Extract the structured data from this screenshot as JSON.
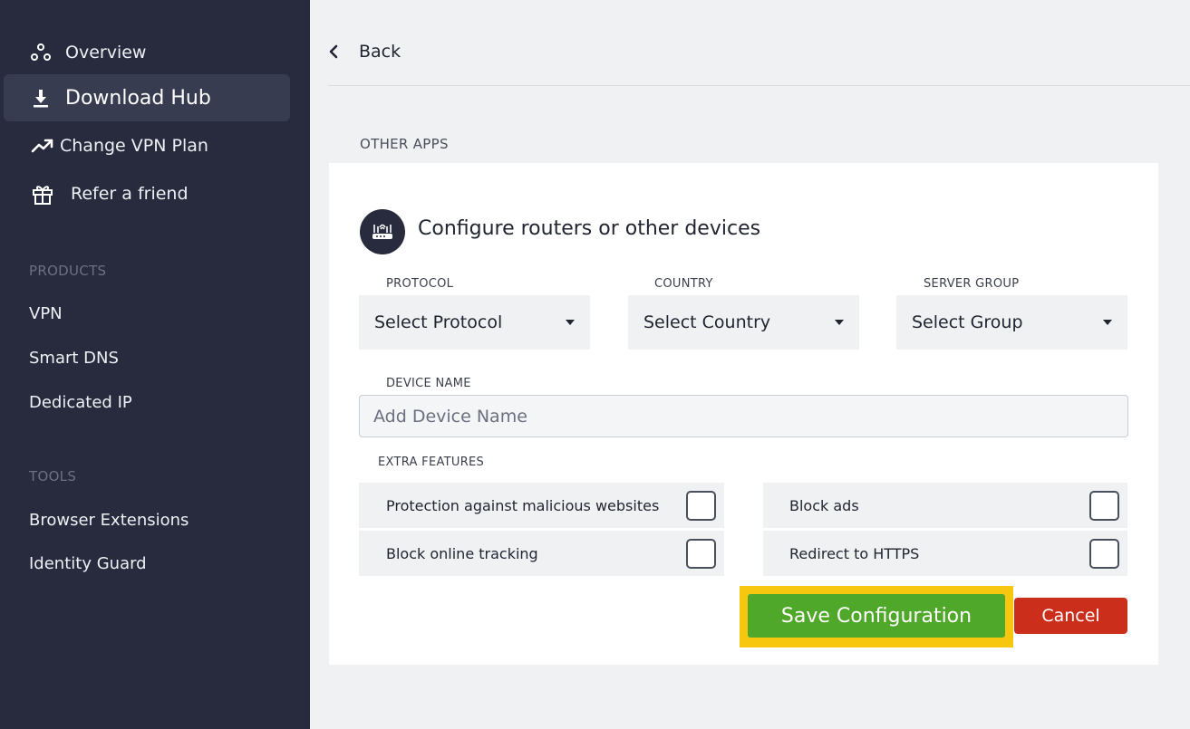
{
  "sidebar": {
    "nav": [
      {
        "label": "Overview",
        "icon": "overview-icon"
      },
      {
        "label": "Download Hub",
        "icon": "download-icon",
        "active": true
      },
      {
        "label": "Change VPN Plan",
        "icon": "trending-up-icon"
      },
      {
        "label": "Refer a friend",
        "icon": "gift-icon"
      }
    ],
    "products_heading": "PRODUCTS",
    "products": [
      "VPN",
      "Smart DNS",
      "Dedicated IP"
    ],
    "tools_heading": "TOOLS",
    "tools": [
      "Browser Extensions",
      "Identity Guard"
    ]
  },
  "header": {
    "back_label": "Back"
  },
  "section_heading": "OTHER APPS",
  "card": {
    "title": "Configure routers or other devices",
    "protocol": {
      "label": "PROTOCOL",
      "value": "Select Protocol"
    },
    "country": {
      "label": "COUNTRY",
      "value": "Select Country"
    },
    "server_group": {
      "label": "SERVER GROUP",
      "value": "Select Group"
    },
    "device_name": {
      "label": "DEVICE NAME",
      "placeholder": "Add Device Name",
      "value": ""
    },
    "extra_features_label": "EXTRA FEATURES",
    "features": [
      {
        "label": "Protection against malicious websites",
        "checked": false
      },
      {
        "label": "Block ads",
        "checked": false
      },
      {
        "label": "Block online tracking",
        "checked": false
      },
      {
        "label": "Redirect to HTTPS",
        "checked": false
      }
    ],
    "save_label": "Save Configuration",
    "cancel_label": "Cancel"
  },
  "colors": {
    "sidebar_bg": "#272b3d",
    "save_green": "#4fa82a",
    "cancel_red": "#cc2e1c",
    "highlight_yellow": "#f7c70f"
  }
}
